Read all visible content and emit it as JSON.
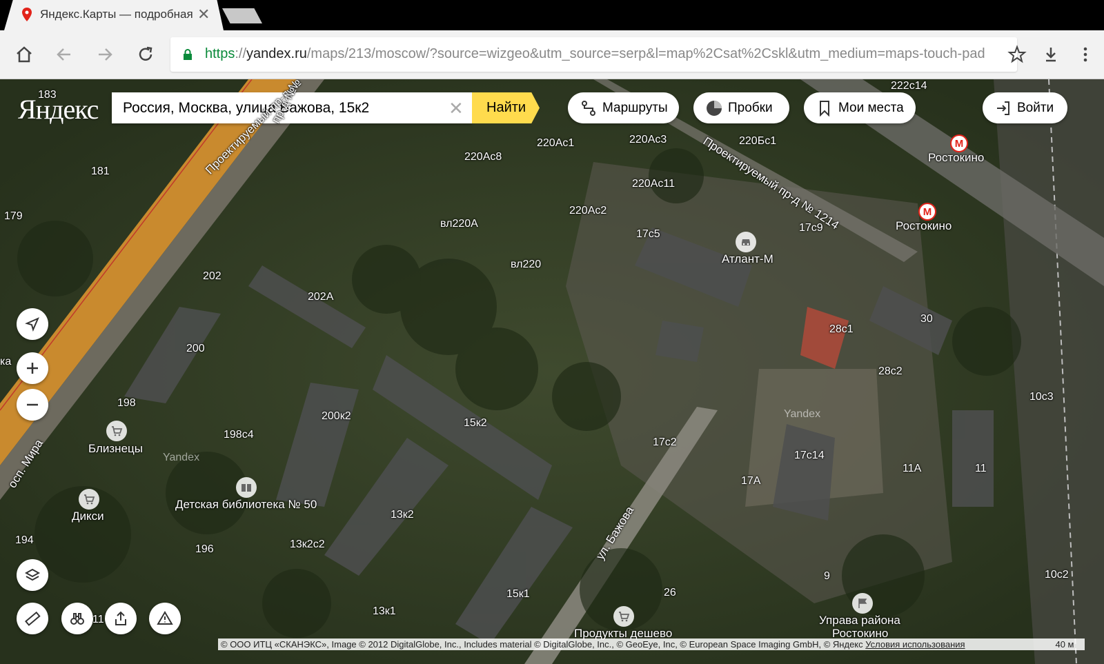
{
  "browser": {
    "tab_title": "Яндекс.Карты — подробная",
    "url_scheme": "https",
    "url_host": "yandex.ru",
    "url_path": "/maps/213/moscow/?source=wizgeo&utm_source=serp&l=map%2Csat%2Cskl&utm_medium=maps-touch-pad"
  },
  "colors": {
    "accent_yellow": "#ffdb4d",
    "metro_red": "#e2231a",
    "https_green": "#0a8a3a"
  },
  "map": {
    "logo": "Яндекс",
    "search": {
      "value": "Россия, Москва, улица Бажова, 15к2",
      "button": "Найти"
    },
    "pills": {
      "routes": "Маршруты",
      "traffic": "Пробки",
      "places": "Мои места",
      "login": "Войти"
    },
    "labels": {
      "b183": "183",
      "b181": "181",
      "b179": "179",
      "b202": "202",
      "b202a": "202А",
      "b200": "200",
      "b198": "198",
      "b198c4": "198с4",
      "b200k2": "200к2",
      "b15k2": "15к2",
      "b13k2": "13к2",
      "b13k2c2": "13к2с2",
      "b196": "196",
      "b194": "194",
      "b13k1": "13к1",
      "b15k1": "15к1",
      "b11": "11",
      "b220ac8": "220Ас8",
      "b220ac1": "220Ас1",
      "b220ac3": "220Ас3",
      "b220ac11": "220Ас11",
      "b220ac2": "220Ас2",
      "b220bc1": "220Бс1",
      "b222c14": "222с14",
      "bvl220a": "вл220А",
      "bvl220": "вл220",
      "b17c5": "17с5",
      "b17c9": "17с9",
      "b17c2": "17с2",
      "b17c14": "17с14",
      "b17a": "17А",
      "b28c1": "28с1",
      "b28c2": "28с2",
      "b30": "30",
      "b10c3": "10с3",
      "b11a": "11А",
      "b11b": "11",
      "b10c2": "10с2",
      "b9": "9",
      "b26": "26",
      "street1": "Проектируемый пр-д №",
      "street2": "Проектируемый пр-д № 1214",
      "street3": "ул. Бажова",
      "street4": "осп. Мира",
      "street5": "пр-д №",
      "partial_ka": "ка",
      "wm1": "Yandex",
      "wm2": "Yandex"
    },
    "pois": {
      "atlant": "Атлант-М",
      "bliznetsy": "Близнецы",
      "diksi": "Дикси",
      "library": "Детская библиотека № 50",
      "produkty": "Продукты дешево",
      "uprava_line1": "Управа района",
      "uprava_line2": "Ростокино",
      "metro1": "Ростокино",
      "metro2": "Ростокино"
    },
    "copyright": "© ООО ИТЦ «СКАНЭКС», Image © 2012 DigitalGlobe, Inc., Includes material © DigitalGlobe, Inc., © GeoEye, Inc, © European Space Imaging GmbH, © Яндекс",
    "terms": "Условия использования",
    "scale": "40 м"
  }
}
